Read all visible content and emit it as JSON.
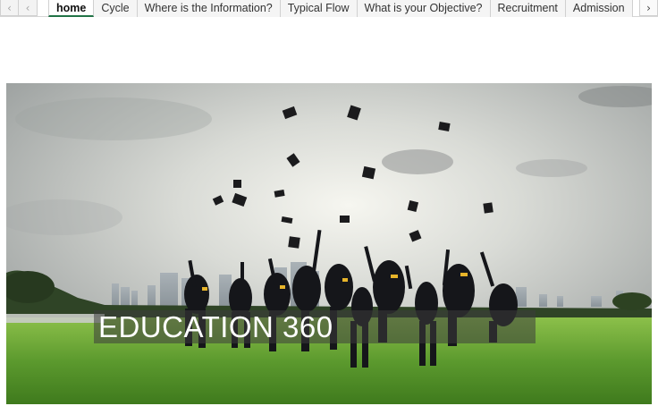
{
  "sheet_tabs": {
    "nav_prev_icon": "chevron-left-icon",
    "nav_next_icon": "chevron-right-icon",
    "items": [
      {
        "label": "home",
        "active": true
      },
      {
        "label": "Cycle",
        "active": false
      },
      {
        "label": "Where is the Information?",
        "active": false
      },
      {
        "label": "Typical Flow",
        "active": false
      },
      {
        "label": "What is your Objective?",
        "active": false
      },
      {
        "label": "Recruitment",
        "active": false
      },
      {
        "label": "Admission",
        "active": false
      }
    ]
  },
  "hero": {
    "title": "EDUCATION 360",
    "image": "graduates-throwing-caps-photo"
  },
  "colors": {
    "active_tab_underline": "#217346",
    "banner_overlay": "#3c3c3c",
    "grass": "#5c9a2e",
    "sky": "#c8cbc6"
  }
}
